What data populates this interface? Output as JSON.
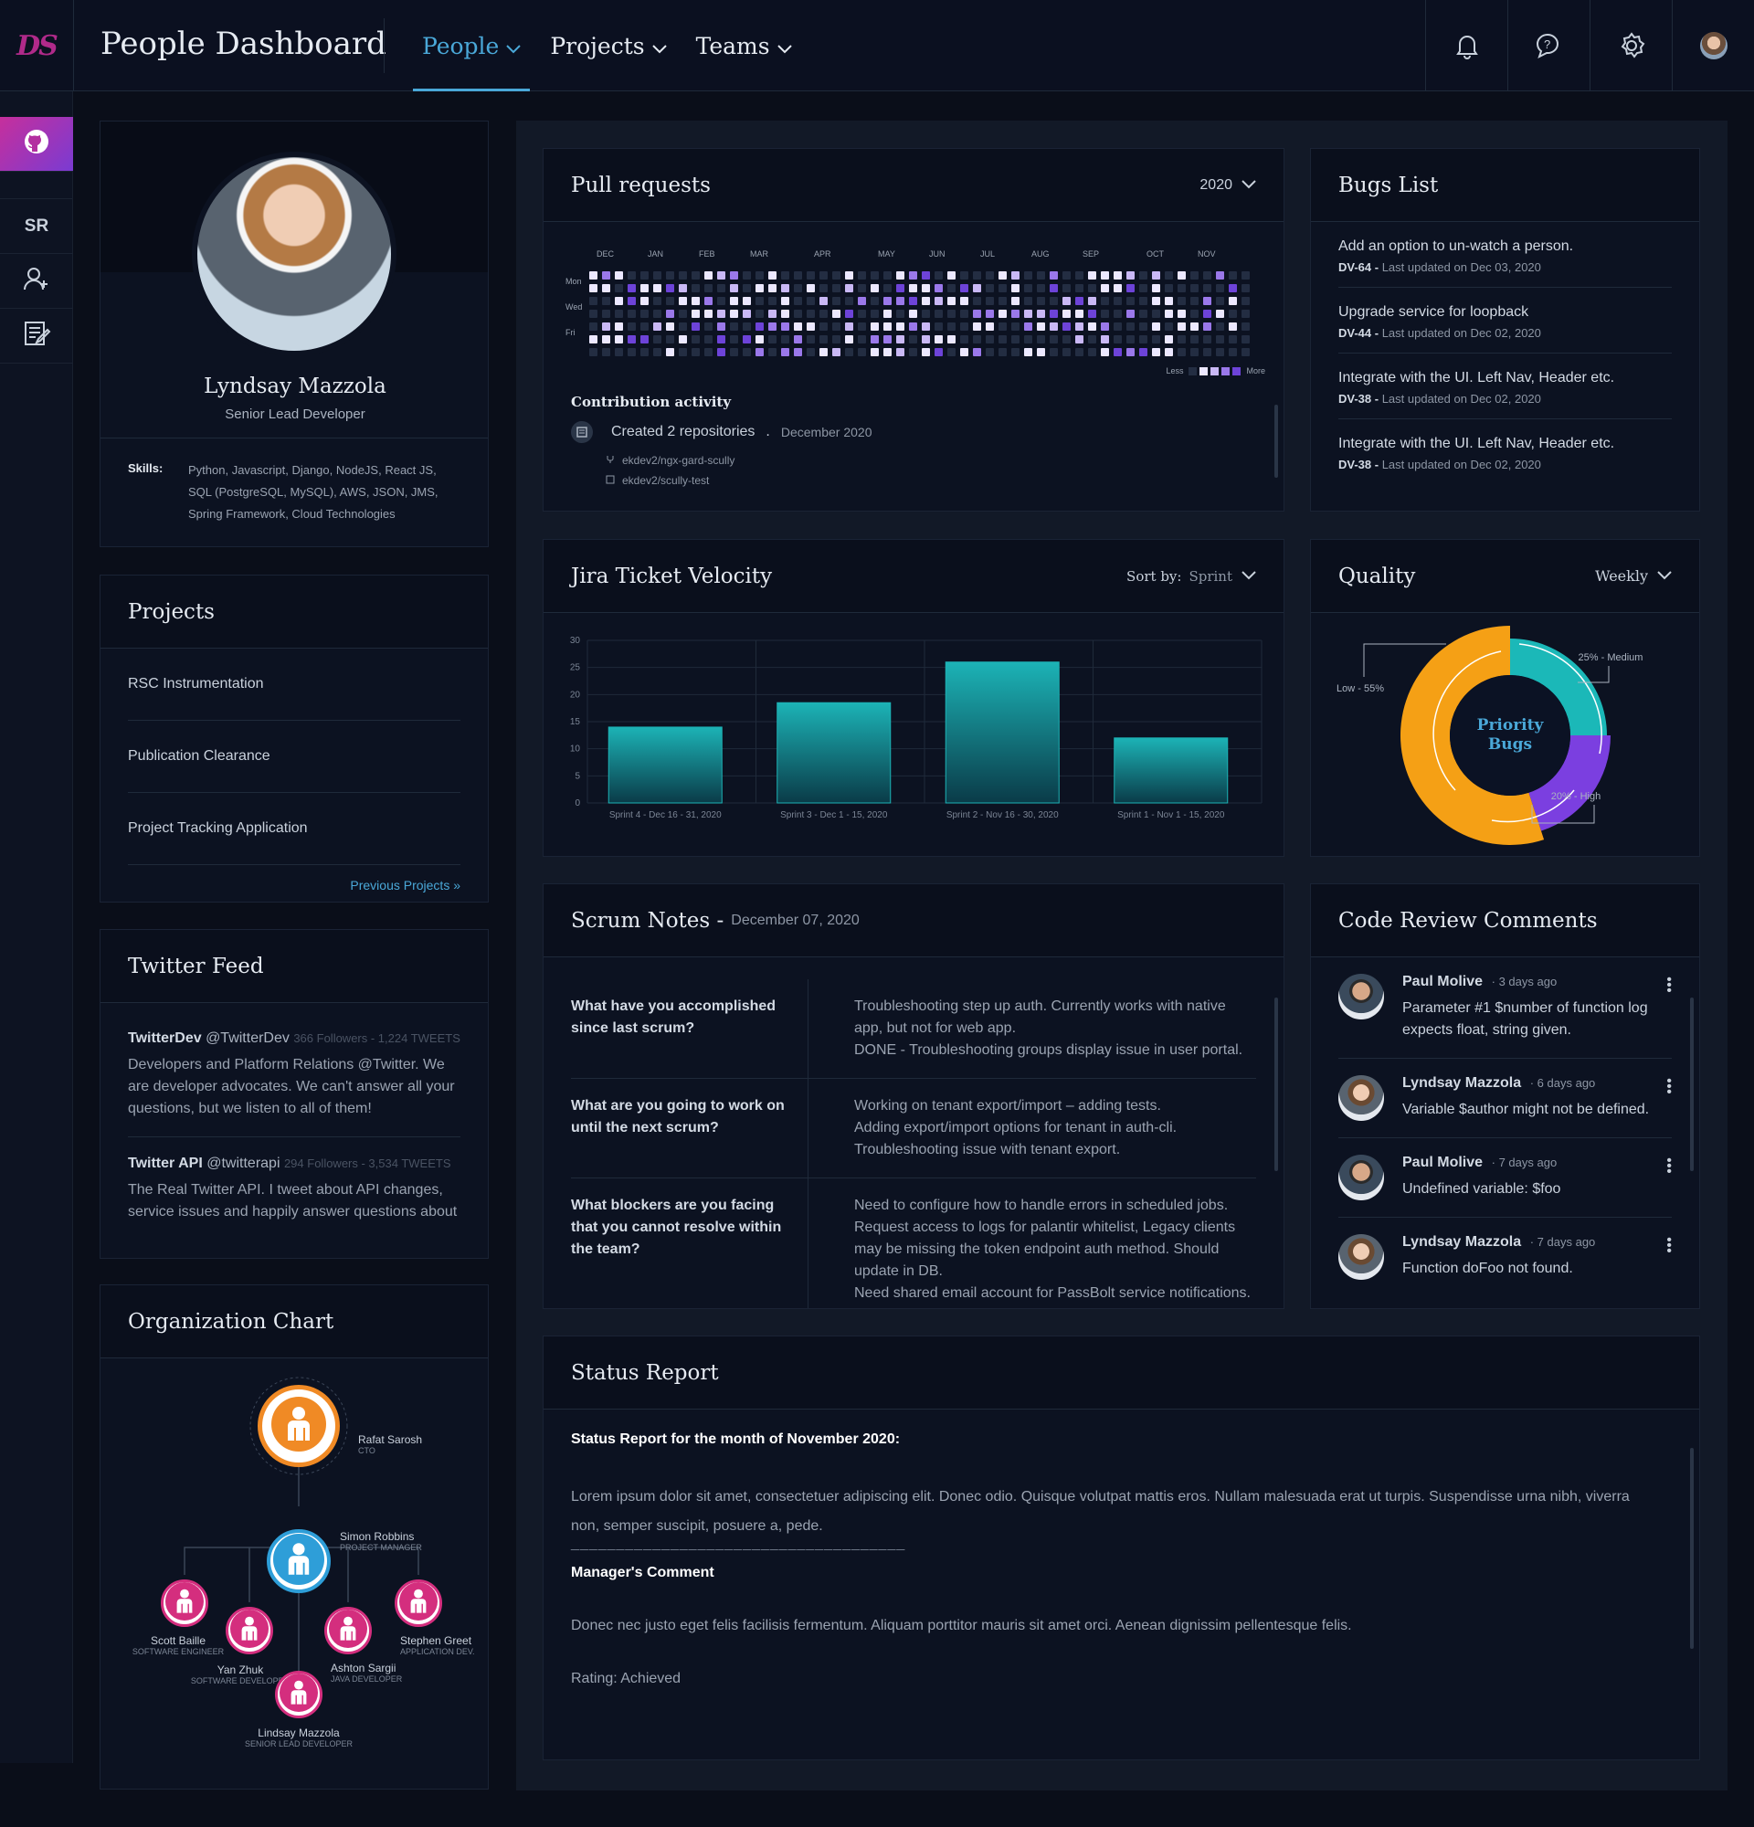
{
  "header": {
    "logo_text": "DS",
    "title": "People Dashboard",
    "nav": [
      {
        "label": "People",
        "active": true
      },
      {
        "label": "Projects",
        "active": false
      },
      {
        "label": "Teams",
        "active": false
      }
    ],
    "icons": [
      "bell-icon",
      "help-chat-icon",
      "gear-icon",
      "user-avatar"
    ]
  },
  "sidebar": {
    "items": [
      {
        "icon": "github-icon",
        "active": true
      },
      {
        "label": "SR"
      },
      {
        "icon": "add-user-icon"
      },
      {
        "icon": "edit-document-icon"
      }
    ]
  },
  "profile": {
    "name": "Lyndsay Mazzola",
    "role": "Senior Lead Developer",
    "skills_label": "Skills:",
    "skills": "Python, Javascript, Django, NodeJS, React JS, SQL (PostgreSQL, MySQL), AWS, JSON, JMS, Spring Framework, Cloud Technologies"
  },
  "projects": {
    "title": "Projects",
    "items": [
      "RSC Instrumentation",
      "Publication Clearance",
      "Project Tracking Application"
    ],
    "more_link": "Previous Projects »"
  },
  "twitter": {
    "title": "Twitter Feed",
    "items": [
      {
        "name": "TwitterDev",
        "handle": "@TwitterDev",
        "stats": "366 Followers - 1,224 TWEETS",
        "text": "Developers and Platform Relations @Twitter. We are developer advocates. We can't answer all your questions, but we listen to all of them!"
      },
      {
        "name": "Twitter API",
        "handle": "@twitterapi",
        "stats": "294 Followers - 3,534 TWEETS",
        "text": "The Real Twitter API. I tweet about API changes, service issues and happily answer questions about"
      }
    ]
  },
  "org": {
    "title": "Organization Chart",
    "people": [
      {
        "name": "Rafat Sarosh",
        "role": "CTO"
      },
      {
        "name": "Simon Robbins",
        "role": "PROJECT MANAGER"
      },
      {
        "name": "Scott Baille",
        "role": "SOFTWARE ENGINEER"
      },
      {
        "name": "Yan Zhuk",
        "role": "SOFTWARE DEVELOPER"
      },
      {
        "name": "Ashton Sargii",
        "role": "JAVA DEVELOPER"
      },
      {
        "name": "Stephen Greet",
        "role": "APPLICATION DEV."
      },
      {
        "name": "Lindsay Mazzola",
        "role": "SENIOR LEAD DEVELOPER"
      }
    ]
  },
  "pull_requests": {
    "title": "Pull requests",
    "year": "2020",
    "months": [
      "DEC",
      "JAN",
      "FEB",
      "MAR",
      "APR",
      "MAY",
      "JUN",
      "JUL",
      "AUG",
      "SEP",
      "OCT",
      "NOV"
    ],
    "days": [
      "Mon",
      "Wed",
      "Fri"
    ],
    "legend_less": "Less",
    "legend_more": "More",
    "activity_title": "Contribution activity",
    "activity_text": "Created 2 repositories",
    "activity_date": "December 2020",
    "repos": [
      "ekdev2/ngx-gard-scully",
      "ekdev2/scully-test"
    ]
  },
  "bugs": {
    "title": "Bugs List",
    "items": [
      {
        "title": "Add an option to un-watch a person.",
        "id": "DV-64 -",
        "updated": "Last updated on Dec 03, 2020"
      },
      {
        "title": "Upgrade service for loopback",
        "id": "DV-44 -",
        "updated": "Last updated on Dec 02, 2020"
      },
      {
        "title": "Integrate with the UI. Left Nav, Header etc.",
        "id": "DV-38 -",
        "updated": "Last updated on Dec 02, 2020"
      },
      {
        "title": "Integrate with the UI. Left Nav, Header etc.",
        "id": "DV-38 -",
        "updated": "Last updated on Dec 02, 2020"
      }
    ]
  },
  "jira": {
    "title": "Jira Ticket Velocity",
    "sort_label": "Sort by:",
    "sort_value": "Sprint"
  },
  "chart_data": [
    {
      "type": "bar",
      "title": "Jira Ticket Velocity",
      "categories": [
        "Sprint 4 - Dec 16 - 31, 2020",
        "Sprint 3 - Dec 1 - 15, 2020",
        "Sprint 2 - Nov 16 - 30, 2020",
        "Sprint 1 - Nov 1 - 15, 2020"
      ],
      "values": [
        14,
        18.5,
        26,
        12
      ],
      "yticks": [
        0,
        5,
        10,
        15,
        20,
        25,
        30
      ],
      "ylim": [
        0,
        30
      ],
      "color": "#17a9ad"
    },
    {
      "type": "pie",
      "title": "Quality",
      "center_label": "Priority Bugs",
      "slices": [
        {
          "label": "Low - 55%",
          "value": 55,
          "color": "#f5a015"
        },
        {
          "label": "25% - Medium",
          "value": 25,
          "color": "#1bb8b8"
        },
        {
          "label": "20% - High",
          "value": 20,
          "color": "#7b3fe0"
        }
      ]
    }
  ],
  "quality": {
    "title": "Quality",
    "period": "Weekly",
    "center_line1": "Priority",
    "center_line2": "Bugs",
    "low": "Low - 55%",
    "medium": "25% - Medium",
    "high": "20% - High"
  },
  "scrum": {
    "title": "Scrum Notes -",
    "date": "December 07, 2020",
    "rows": [
      {
        "q": "What have you accomplished since last scrum?",
        "a": [
          "Troubleshooting step up auth.  Currently works with native app, but not for web app.",
          "DONE - Troubleshooting groups display issue in user portal."
        ]
      },
      {
        "q": "What are you going to work on until the next scrum?",
        "a": [
          "Working on tenant export/import – adding tests.",
          "Adding export/import options for tenant in auth-cli.",
          "Troubleshooting issue with tenant export."
        ]
      },
      {
        "q": "What blockers are you facing that you cannot resolve within the team?",
        "a": [
          "Need to configure how to handle errors in scheduled jobs.",
          "Request access to logs for palantir whitelist, Legacy clients may be missing the token endpoint auth method.  Should update in DB.",
          "Need shared email account for PassBolt service notifications."
        ]
      }
    ]
  },
  "code_review": {
    "title": "Code Review Comments",
    "items": [
      {
        "name": "Paul Molive",
        "time": "3 days ago",
        "text": "Parameter #1 $number of function log expects float, string given.",
        "gender": "m"
      },
      {
        "name": "Lyndsay Mazzola",
        "time": "6 days ago",
        "text": "Variable $author might not be defined.",
        "gender": "f"
      },
      {
        "name": "Paul Molive",
        "time": "7 days ago",
        "text": "Undefined variable: $foo",
        "gender": "m"
      },
      {
        "name": "Lyndsay Mazzola",
        "time": "7 days ago",
        "text": "Function doFoo not found.",
        "gender": "f"
      }
    ]
  },
  "status": {
    "title": "Status Report",
    "heading": "Status Report for the month of November 2020:",
    "body": "Lorem ipsum dolor sit amet, consectetuer adipiscing elit. Donec odio. Quisque volutpat mattis eros. Nullam malesuada erat ut turpis. Suspendisse urna nibh, viverra non, semper suscipit, posuere a, pede.",
    "separator": "_____________________________________",
    "manager_heading": "Manager's Comment",
    "manager_body": "Donec nec justo eget felis facilisis fermentum. Aliquam porttitor mauris sit amet orci. Aenean dignissim pellentesque felis.",
    "rating": "Rating: Achieved"
  }
}
